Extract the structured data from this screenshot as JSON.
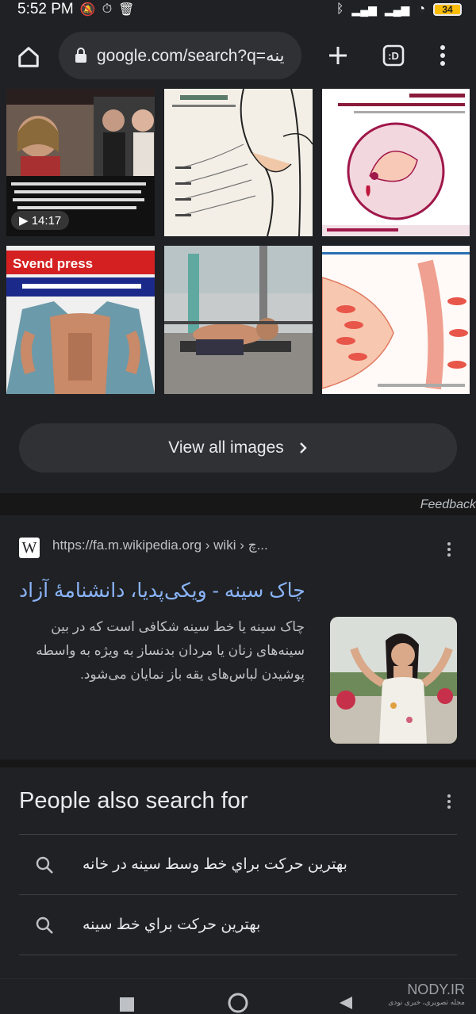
{
  "status": {
    "time": "5:52 PM",
    "battery": "34"
  },
  "toolbar": {
    "url": "google.com/search?q=ينه"
  },
  "images": {
    "video_duration": "14:17",
    "view_all_label": "View all images"
  },
  "feedback_label": "Feedback",
  "result": {
    "logo": "W",
    "url": "https://fa.m.wikipedia.org › wiki › چ...",
    "title": "چاک سینه - ویکی‌پدیا، دانشنامهٔ آزاد",
    "snippet": "چاک سینه یا خط سینه شکافی است که در بین سینه‌های زنان یا مردان بدنساز به ویژه به واسطه پوشیدن لباس‌های یقه باز نمایان می‌شود."
  },
  "people_also_search": {
    "title": "People also search for",
    "items": [
      "بهترین حرکت براي خط وسط سینه در خانه",
      "بهترین حرکت براي خط سینه"
    ]
  },
  "watermark": {
    "brand": "NODY.IR",
    "sub": "مجله تصویری، خبری نودی"
  },
  "colors": {
    "background": "#202124",
    "surface": "#303134",
    "link": "#8ab4f8",
    "text": "#e8eaed",
    "muted": "#bdc1c6"
  }
}
